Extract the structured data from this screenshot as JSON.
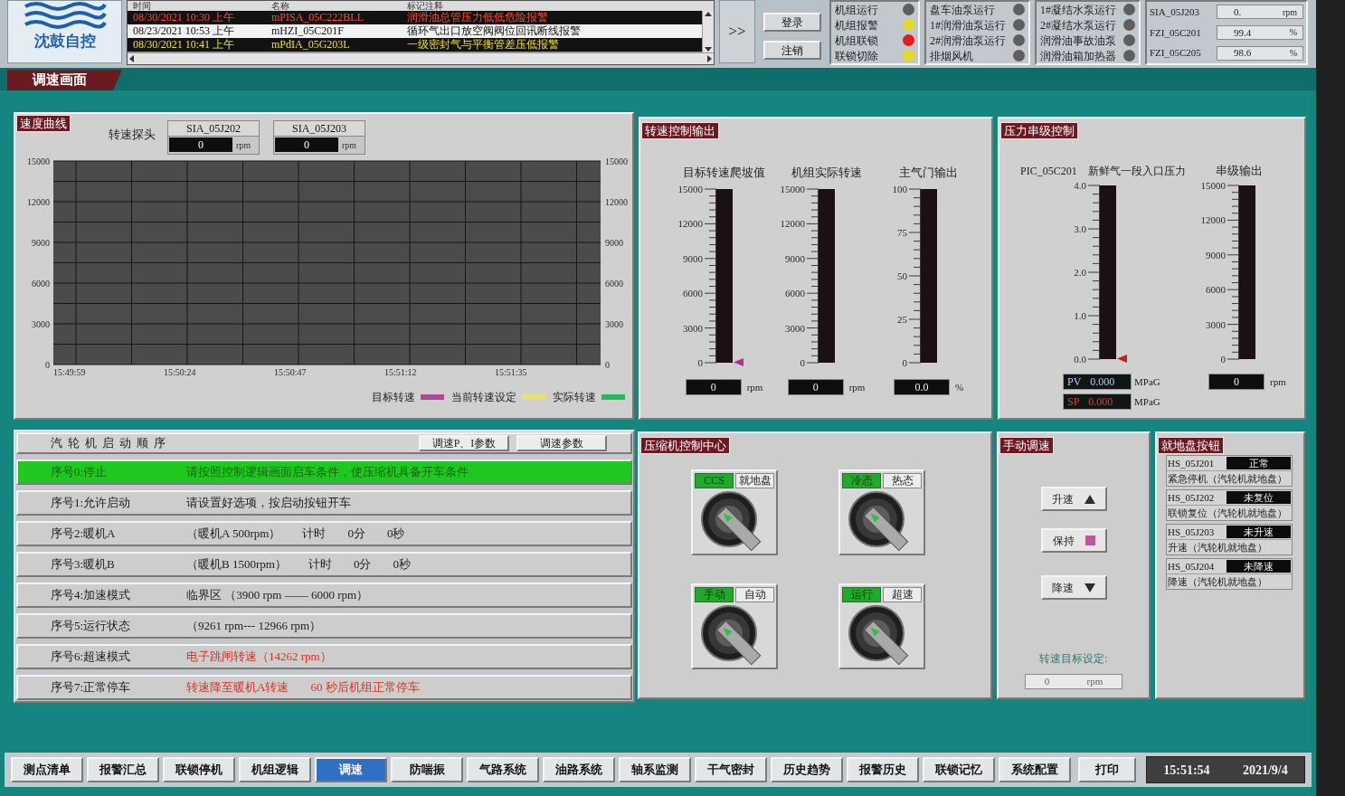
{
  "header": {
    "logo_text": "沈鼓自控",
    "alarm_table": {
      "columns": [
        "时间",
        "名称",
        "标记注释"
      ],
      "rows": [
        {
          "time": "08/30/2021 10:30 上午",
          "name": "mPISA_05C222BLL",
          "note": "润滑油总管压力低低危险报警",
          "kind": "alarm"
        },
        {
          "time": "08/23/2021 10:53 上午",
          "name": "mHZI_05C201F",
          "note": "循环气出口放空阀阀位回讯断线报警",
          "kind": "acknowledged"
        },
        {
          "time": "08/30/2021 10:41 上午",
          "name": "mPdIA_05G203L",
          "note": "一级密封气与平衡管差压低报警",
          "kind": "warning"
        }
      ]
    },
    "expand_button": ">>",
    "login_buttons": [
      "登录",
      "注销"
    ],
    "status_panels": [
      {
        "lights": [
          {
            "label": "机组运行",
            "color": "#5e5e5e"
          },
          {
            "label": "机组报警",
            "color": "#e4dc1c"
          },
          {
            "label": "机组联锁",
            "color": "#e01c1c"
          },
          {
            "label": "联锁切除",
            "color": "#e4dc1c"
          }
        ]
      },
      {
        "lights": [
          {
            "label": "盘车油泵运行",
            "color": "#5e5e5e"
          },
          {
            "label": "1#润滑油泵运行",
            "color": "#5e5e5e"
          },
          {
            "label": "2#润滑油泵运行",
            "color": "#5e5e5e"
          },
          {
            "label": "排烟风机",
            "color": "#5e5e5e"
          }
        ]
      },
      {
        "lights": [
          {
            "label": "1#凝结水泵运行",
            "color": "#5e5e5e"
          },
          {
            "label": "2#凝结水泵运行",
            "color": "#5e5e5e"
          },
          {
            "label": "润滑油事故油泵",
            "color": "#5e5e5e"
          },
          {
            "label": "润滑油箱加热器",
            "color": "#5e5e5e"
          }
        ]
      }
    ],
    "readings": [
      {
        "tag": "SIA_05J203",
        "value": "0.",
        "unit": "rpm"
      },
      {
        "tag": "FZI_05C201",
        "value": "99.4",
        "unit": "%"
      },
      {
        "tag": "FZI_05C205",
        "value": "98.6",
        "unit": "%"
      }
    ]
  },
  "screen_tab": "调速画面",
  "speed_curve": {
    "title": "速度曲线",
    "probe_label": "转速探头",
    "probes": [
      {
        "tag": "SIA_05J202",
        "value": "0",
        "unit": "rpm"
      },
      {
        "tag": "SIA_05J203",
        "value": "0",
        "unit": "rpm"
      }
    ],
    "right_axis_labels": [
      "15000",
      "12000",
      "9000",
      "6000",
      "3000",
      "0"
    ],
    "chart_data": {
      "type": "line",
      "grid": true,
      "categories": [
        "15:49:59",
        "15:50:24",
        "15:50:47",
        "15:51:12",
        "15:51:35"
      ],
      "ylim": [
        0,
        15000
      ],
      "yticks": [
        0,
        3000,
        6000,
        9000,
        12000,
        15000
      ],
      "series": [
        {
          "name": "目标转速",
          "color": "#b04898",
          "values": [
            null,
            null,
            null,
            null,
            null
          ]
        },
        {
          "name": "当前转速设定",
          "color": "#e8e070",
          "values": [
            null,
            null,
            null,
            null,
            null
          ]
        },
        {
          "name": "实际转速",
          "color": "#28b860",
          "values": [
            null,
            null,
            null,
            null,
            null
          ]
        }
      ]
    }
  },
  "speed_output": {
    "title": "转速控制输出",
    "gauges": [
      {
        "title": "目标转速爬坡值",
        "ticks": [
          "15000",
          "12000",
          "9000",
          "6000",
          "3000",
          "0"
        ],
        "level": 0,
        "marker": {
          "color": "#b0308a"
        },
        "reading": "0",
        "unit": "rpm"
      },
      {
        "title": "机组实际转速",
        "ticks": [
          "15000",
          "12000",
          "9000",
          "6000",
          "3000",
          "0"
        ],
        "level": 0,
        "reading": "0",
        "unit": "rpm"
      },
      {
        "title": "主气门输出",
        "ticks": [
          "100",
          "75",
          "50",
          "25",
          "0"
        ],
        "level": 0,
        "reading": "0.0",
        "unit": "%"
      }
    ]
  },
  "pressure_cascade": {
    "title": "压力串级控制",
    "tag": "PIC_05C201",
    "gauges": [
      {
        "title": "新鲜气一段入口压力",
        "ticks": [
          "4.0",
          "3.0",
          "2.0",
          "1.0",
          "0.0"
        ],
        "level": 0,
        "marker": {
          "color": "#c81e1e"
        },
        "readouts": [
          {
            "label": "PV",
            "value": "0.000",
            "unit": "MPaG",
            "kind": "pv"
          },
          {
            "label": "SP",
            "value": "0.000",
            "unit": "MPaG",
            "kind": "sp"
          }
        ]
      },
      {
        "title": "串级输出",
        "ticks": [
          "15000",
          "12000",
          "9000",
          "6000",
          "3000",
          "0"
        ],
        "level": 0,
        "reading": "0",
        "unit": "rpm"
      }
    ]
  },
  "start_sequence": {
    "title": "汽轮机启动顺序",
    "buttons": [
      "调速P、I参数",
      "调速参数"
    ],
    "steps": [
      {
        "label": "序号0:停止",
        "selected": true,
        "parts": [
          {
            "text": "请按照控制逻辑画面启车条件，使压缩机具备开车条件",
            "kind": "normal"
          }
        ]
      },
      {
        "label": "序号1:允许启动",
        "selected": false,
        "parts": [
          {
            "text": "请设置好选项，按启动按钮开车",
            "kind": "normal"
          }
        ]
      },
      {
        "label": "序号2:暖机A",
        "selected": false,
        "parts": [
          {
            "text": "（暖机A 500rpm）",
            "kind": "normal"
          },
          {
            "text": "计时",
            "kind": "normal"
          },
          {
            "text": "0分",
            "kind": "normal"
          },
          {
            "text": "0秒",
            "kind": "normal"
          }
        ]
      },
      {
        "label": "序号3:暖机B",
        "selected": false,
        "parts": [
          {
            "text": "（暖机B 1500rpm）",
            "kind": "normal"
          },
          {
            "text": "计时",
            "kind": "normal"
          },
          {
            "text": "0分",
            "kind": "normal"
          },
          {
            "text": "0秒",
            "kind": "normal"
          }
        ]
      },
      {
        "label": "序号4:加速模式",
        "selected": false,
        "parts": [
          {
            "text": "临界区 （3900 rpm —— 6000 rpm）",
            "kind": "normal"
          }
        ]
      },
      {
        "label": "序号5:运行状态",
        "selected": false,
        "parts": [
          {
            "text": "（9261 rpm--- 12966 rpm）",
            "kind": "normal"
          }
        ]
      },
      {
        "label": "序号6:超速模式",
        "selected": false,
        "parts": [
          {
            "text": "电子跳闸转速（14262 rpm）",
            "kind": "alert"
          }
        ]
      },
      {
        "label": "序号7:正常停车",
        "selected": false,
        "parts": [
          {
            "text": "转速降至暖机A转速",
            "kind": "alert"
          },
          {
            "text": "60 秒后机组正常停车",
            "kind": "alert"
          }
        ]
      }
    ]
  },
  "compressor_control": {
    "title": "压缩机控制中心",
    "switches": [
      {
        "options": [
          {
            "label": "CCS",
            "selected": true
          },
          {
            "label": "就地盘",
            "selected": false
          }
        ]
      },
      {
        "options": [
          {
            "label": "冷态",
            "selected": true
          },
          {
            "label": "热态",
            "selected": false
          }
        ]
      },
      {
        "options": [
          {
            "label": "手动",
            "selected": true
          },
          {
            "label": "自动",
            "selected": false
          }
        ]
      },
      {
        "options": [
          {
            "label": "运行",
            "selected": true
          },
          {
            "label": "超速",
            "selected": false
          }
        ]
      }
    ]
  },
  "manual_speed": {
    "title": "手动调速",
    "buttons": [
      {
        "label": "升速",
        "kind": "up"
      },
      {
        "label": "保持",
        "kind": "hold"
      },
      {
        "label": "降速",
        "kind": "down"
      }
    ],
    "target_label": "转速目标设定:",
    "target_value": "0",
    "target_unit": "rpm"
  },
  "local_panel": {
    "title": "就地盘按钮",
    "items": [
      {
        "tag": "HS_05J201",
        "status": "正常",
        "description": "紧急停机（汽轮机就地盘）"
      },
      {
        "tag": "HS_05J202",
        "status": "未复位",
        "description": "联锁复位（汽轮机就地盘）"
      },
      {
        "tag": "HS_05J203",
        "status": "未升速",
        "description": "升速（汽轮机就地盘）"
      },
      {
        "tag": "HS_05J204",
        "status": "未降速",
        "description": "降速（汽轮机就地盘）"
      }
    ]
  },
  "nav": {
    "tabs": [
      {
        "label": "测点清单",
        "selected": false
      },
      {
        "label": "报警汇总",
        "selected": false
      },
      {
        "label": "联锁停机",
        "selected": false
      },
      {
        "label": "机组逻辑",
        "selected": false
      },
      {
        "label": "调速",
        "selected": true
      },
      {
        "label": "防喘振",
        "selected": false
      },
      {
        "label": "气路系统",
        "selected": false
      },
      {
        "label": "油路系统",
        "selected": false
      },
      {
        "label": "轴系监测",
        "selected": false
      },
      {
        "label": "干气密封",
        "selected": false
      },
      {
        "label": "历史趋势",
        "selected": false
      },
      {
        "label": "报警历史",
        "selected": false
      },
      {
        "label": "联锁记忆",
        "selected": false
      },
      {
        "label": "系统配置",
        "selected": false
      }
    ],
    "print_button": "打印",
    "time": "15:51:54",
    "date": "2021/9/4"
  }
}
